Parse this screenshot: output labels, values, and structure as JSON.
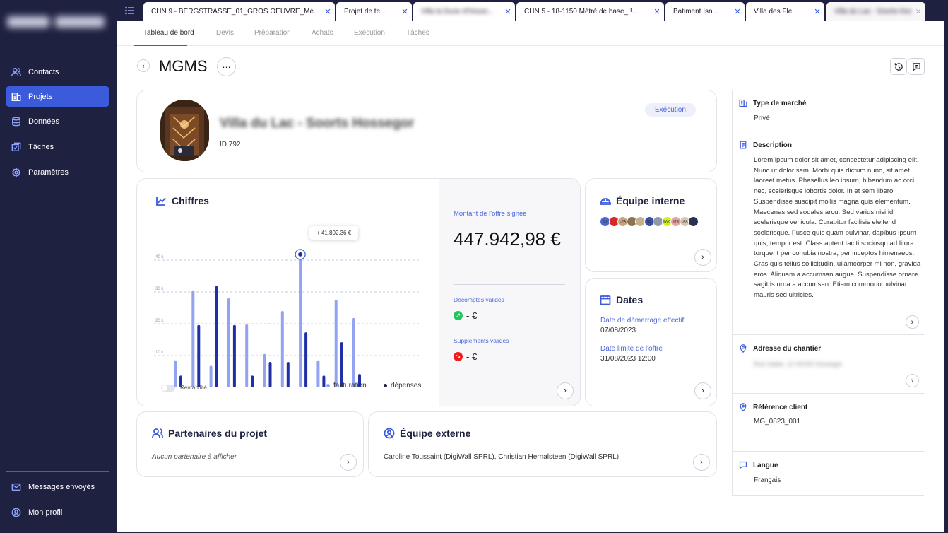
{
  "sidebar": {
    "items": [
      {
        "label": "Contacts",
        "icon": "users-icon"
      },
      {
        "label": "Projets",
        "icon": "building-icon"
      },
      {
        "label": "Données",
        "icon": "database-icon"
      },
      {
        "label": "Tâches",
        "icon": "tasks-icon"
      },
      {
        "label": "Paramètres",
        "icon": "gear-icon"
      }
    ],
    "bottom": [
      {
        "label": "Messages envoyés",
        "icon": "mail-icon"
      },
      {
        "label": "Mon profil",
        "icon": "user-circle-icon"
      }
    ]
  },
  "tabs": [
    {
      "label": "CHN 9 - BERGSTRASSE_01_GROS OEUVRE_Mé..."
    },
    {
      "label": "Projet de te..."
    },
    {
      "label": "Villa la Dune d'Hosse..."
    },
    {
      "label": "CHN 5 - 18-1150 Métré de base_I!..."
    },
    {
      "label": "Batiment Isn..."
    },
    {
      "label": "Villa des Fle..."
    },
    {
      "label": "Villa du Lac - Soorts-Hossegor"
    }
  ],
  "subnav": [
    "Tableau de bord",
    "Devis",
    "Préparation",
    "Achats",
    "Exécution",
    "Tâches"
  ],
  "page": {
    "title": "MGMS",
    "more": "⋯"
  },
  "project": {
    "name": "Villa du Lac - Soorts Hossegor",
    "id": "ID 792",
    "status": "Exécution"
  },
  "figures": {
    "title": "Chiffres",
    "tooltip": "+ 41.802,36 €",
    "rentabilite": "Rentabilité",
    "legend_fact": "facturation",
    "legend_dep": "dépenses",
    "montant_label": "Montant de l'offre signée",
    "montant": "447.942,98 €",
    "decomptes_label": "Décomptes validés",
    "decomptes_value": "- €",
    "supplements_label": "Suppléments validés",
    "supplements_value": "- €"
  },
  "chart_data": {
    "type": "bar",
    "yticks": [
      "40 k",
      "30 k",
      "20 k",
      "10 k"
    ],
    "ylim": [
      0,
      40000
    ],
    "series": [
      {
        "name": "facturation",
        "color": "#93a3f2",
        "values": [
          8500,
          30500,
          6800,
          28000,
          19800,
          10500,
          24000,
          41800,
          8500,
          27500,
          21800
        ]
      },
      {
        "name": "dépenses",
        "color": "#1f2fa6",
        "values": [
          3700,
          19600,
          31800,
          19600,
          3700,
          8000,
          8000,
          17300,
          3700,
          14200,
          4200
        ]
      }
    ]
  },
  "equipe_interne": {
    "title": "Équipe interne",
    "avatars": [
      "CJ",
      "",
      "LPA",
      "",
      "",
      "NS",
      "",
      "EWG",
      "ETE",
      "LPA",
      ""
    ]
  },
  "dates": {
    "title": "Dates",
    "start_label": "Date de démarrage effectif",
    "start": "07/08/2023",
    "limit_label": "Date limite de l'offre",
    "limit": "31/08/2023 12:00"
  },
  "partenaires": {
    "title": "Partenaires du projet",
    "empty": "Aucun partenaire à afficher"
  },
  "equipe_externe": {
    "title": "Équipe externe",
    "members": "Caroline Toussaint (DigiWall SPRL), Christian Hernalsteen (DigiWall SPRL)"
  },
  "details": {
    "type_label": "Type de marché",
    "type": "Privé",
    "description_label": "Description",
    "description": "Lorem ipsum dolor sit amet, consectetur adipiscing elit. Nunc ut dolor sem. Morbi quis dictum nunc, sit amet laoreet metus. Phasellus leo ipsum, bibendum ac orci nec, scelerisque lobortis dolor. In et sem libero. Suspendisse suscipit mollis magna quis elementum. Maecenas sed sodales arcu. Sed varius nisi id scelerisque vehicula. Curabitur facilisis eleifend scelerisque. Fusce quis quam pulvinar, dapibus ipsum quis, tempor est. Class aptent taciti sociosqu ad litora torquent per conubia nostra, per inceptos himenaeos. Cras quis tellus sollicitudin, ullamcorper mi non, gravida eros. Aliquam a accumsan augue. Suspendisse ornare sagittis urna a accumsan. Etiam commodo pulvinar mauris sed ultricies.",
    "adresse_label": "Adresse du chantier",
    "adresse": "Rue Sable, 12 40150 Hossegor",
    "ref_label": "Référence client",
    "ref": "MG_0823_001",
    "langue_label": "Langue",
    "langue": "Français"
  },
  "colors": {
    "accent": "#3b5bdb",
    "sidebar": "#1e2140",
    "bar_light": "#93a3f2",
    "bar_dark": "#1f2fa6"
  }
}
